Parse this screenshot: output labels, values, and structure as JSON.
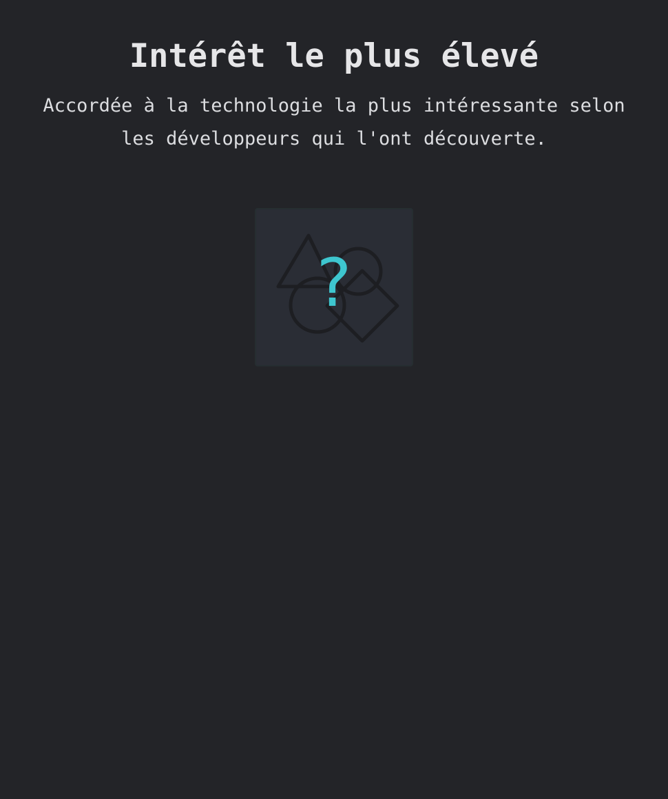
{
  "award": {
    "title": "Intérêt le plus élevé",
    "description": "Accordée à la technologie la plus intéressante selon les développeurs qui l'ont découverte.",
    "placeholder_symbol": "?",
    "placeholder_icon": "shapes-icon",
    "accent_color": "#3ec6cf",
    "background_color": "#232428"
  }
}
